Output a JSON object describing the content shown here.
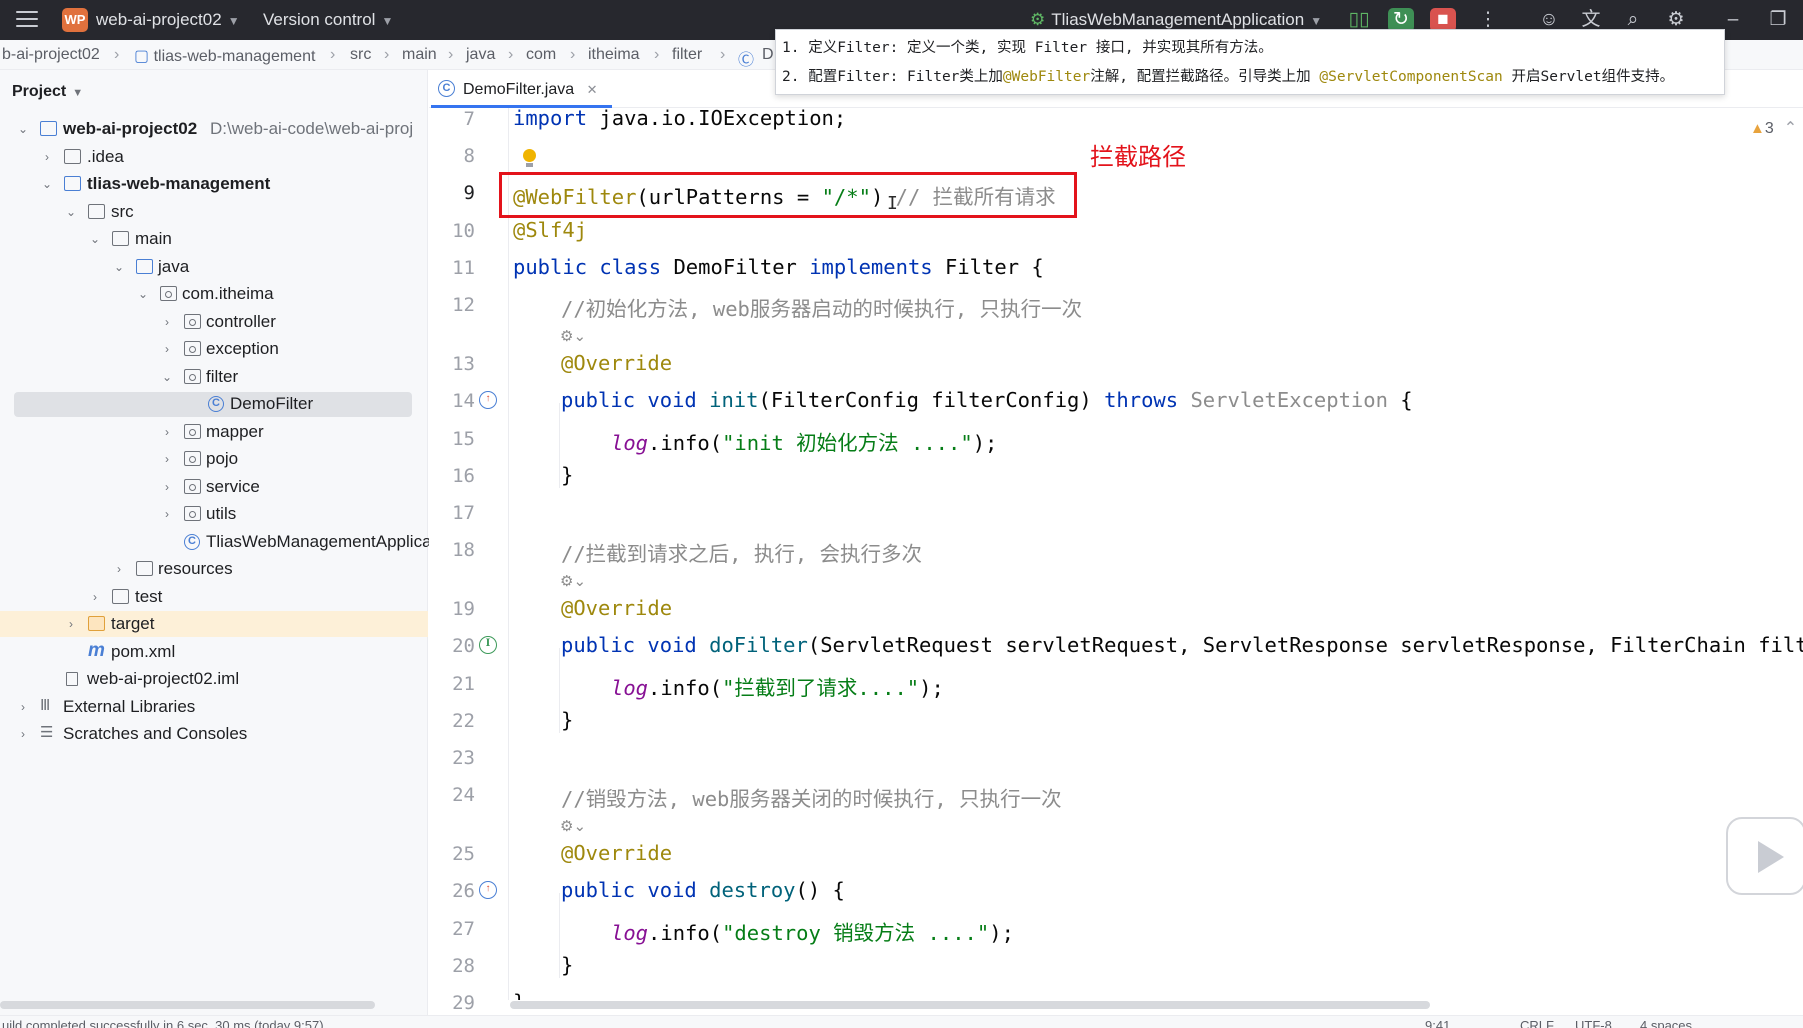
{
  "titlebar": {
    "project_badge": "WP",
    "project_name": "web-ai-project02",
    "version_control": "Version control",
    "run_config": "TliasWebManagementApplication"
  },
  "breadcrumb": [
    "b-ai-project02",
    "tlias-web-management",
    "src",
    "main",
    "java",
    "com",
    "itheima",
    "filter",
    "D"
  ],
  "tooltip": {
    "line1": "1. 定义Filter: 定义一个类, 实现 Filter 接口, 并实现其所有方法。",
    "line2_a": "2. 配置Filter: Filter类上加",
    "line2_b": "@WebFilter",
    "line2_c": "注解, 配置拦截路径。引导类上加 ",
    "line2_d": "@ServletComponentScan",
    "line2_e": " 开启Servlet组件支持。"
  },
  "project_panel": {
    "title": "Project",
    "tree": [
      {
        "label": "web-ai-project02",
        "extra": "D:\\web-ai-code\\web-ai-proj"
      },
      {
        "label": ".idea"
      },
      {
        "label": "tlias-web-management"
      },
      {
        "label": "src"
      },
      {
        "label": "main"
      },
      {
        "label": "java"
      },
      {
        "label": "com.itheima"
      },
      {
        "label": "controller"
      },
      {
        "label": "exception"
      },
      {
        "label": "filter"
      },
      {
        "label": "DemoFilter"
      },
      {
        "label": "mapper"
      },
      {
        "label": "pojo"
      },
      {
        "label": "service"
      },
      {
        "label": "utils"
      },
      {
        "label": "TliasWebManagementApplica"
      },
      {
        "label": "resources"
      },
      {
        "label": "test"
      },
      {
        "label": "target"
      },
      {
        "label": "pom.xml"
      },
      {
        "label": "web-ai-project02.iml"
      },
      {
        "label": "External Libraries"
      },
      {
        "label": "Scratches and Consoles"
      }
    ]
  },
  "editor": {
    "tab_label": "DemoFilter.java",
    "warning_count": "3",
    "annotation_label": "拦截路径",
    "line_numbers": [
      "7",
      "8",
      "9",
      "10",
      "11",
      "12",
      "13",
      "14",
      "15",
      "16",
      "17",
      "18",
      "19",
      "20",
      "21",
      "22",
      "23",
      "24",
      "25",
      "26",
      "27",
      "28",
      "29"
    ],
    "code": {
      "l7_a": "import",
      "l7_b": " java.io.IOException;",
      "l9_a": "@WebFilter",
      "l9_b": "(urlPatterns = ",
      "l9_c": "\"/*\"",
      "l9_d": ") ",
      "l9_e": "// 拦截所有请求",
      "l10": "@Slf4j",
      "l11_a": "public class",
      "l11_b": " DemoFilter ",
      "l11_c": "implements",
      "l11_d": " Filter {",
      "l12": "//初始化方法, web服务器启动的时候执行, 只执行一次",
      "l13": "@Override",
      "l14_a": "public void",
      "l14_b": " init",
      "l14_c": "(FilterConfig filterConfig) ",
      "l14_d": "throws",
      "l14_e": " ServletException",
      "l14_f": " {",
      "l15_a": "log",
      "l15_b": ".info(",
      "l15_c": "\"init 初始化方法 ....\"",
      "l15_d": ");",
      "l16": "}",
      "l18": "//拦截到请求之后, 执行, 会执行多次",
      "l19": "@Override",
      "l20_a": "public void",
      "l20_b": " doFilter",
      "l20_c": "(ServletRequest servletRequest, ServletResponse servletResponse, FilterChain filterC",
      "l21_a": "log",
      "l21_b": ".info(",
      "l21_c": "\"拦截到了请求....\"",
      "l21_d": ");",
      "l22": "}",
      "l24": "//销毁方法, web服务器关闭的时候执行, 只执行一次",
      "l25": "@Override",
      "l26_a": "public void",
      "l26_b": " destroy",
      "l26_c": "() {",
      "l27_a": "log",
      "l27_b": ".info(",
      "l27_c": "\"destroy 销毁方法 ....\"",
      "l27_d": ");",
      "l28": "}",
      "l29": "}"
    }
  },
  "statusbar": {
    "message": "uild completed successfully in 6 sec, 30 ms (today 9:57)",
    "position": "9:41",
    "line_sep": "CRLF",
    "encoding": "UTF-8",
    "indent": "4 spaces"
  },
  "colors": {
    "highlight_red": "#e3131b",
    "accent_blue": "#3574f0",
    "keyword": "#0033b3",
    "annotation": "#9e880d",
    "string": "#067d17",
    "comment": "#8c8c8c"
  }
}
